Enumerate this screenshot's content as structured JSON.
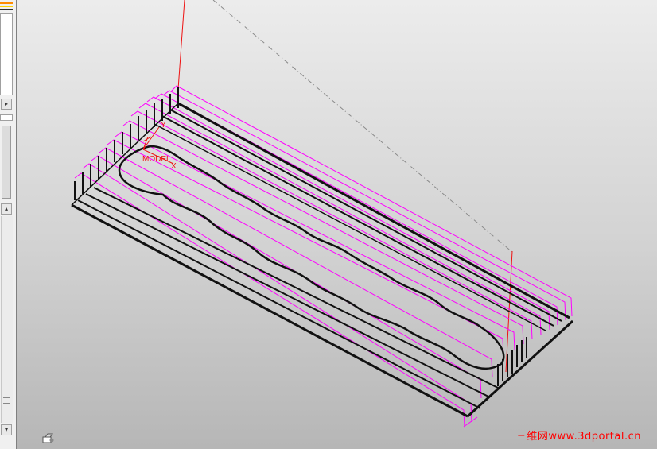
{
  "viewport": {
    "axis_labels": {
      "y": "Y",
      "x": "X",
      "model": "MODEL"
    }
  },
  "left_panel": {
    "scroll_arrow_right": "▸",
    "scroll_arrow_up": "▴",
    "scroll_arrow_down": "▾"
  },
  "watermark": {
    "text": "三维网www.3dportal.cn"
  },
  "colors": {
    "toolpath": "#ff00ff",
    "geometry": "#111111",
    "tool_axis": "#ee1111",
    "rapid": "#888888",
    "accent_orange": "#ff8c00",
    "accent_yellow": "#ffd400"
  },
  "icons": {
    "status_icon": "view-icon"
  }
}
